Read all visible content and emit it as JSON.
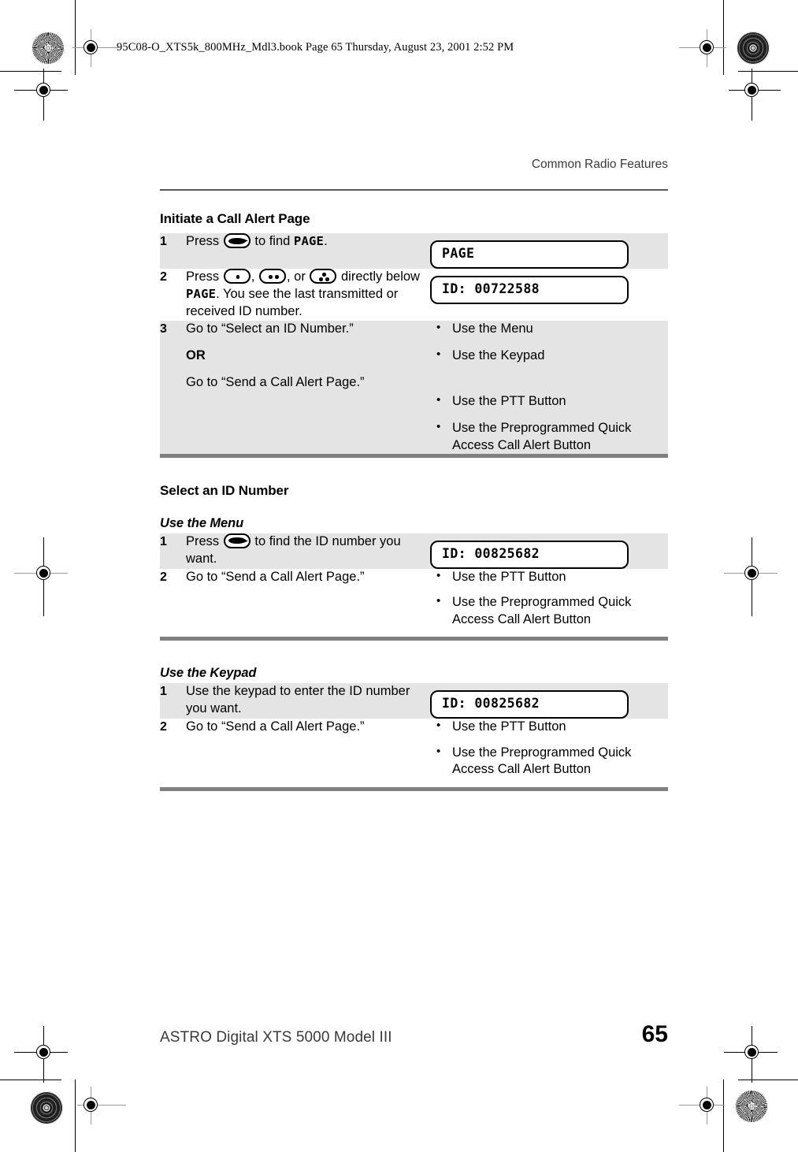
{
  "slug": "95C08-O_XTS5k_800MHz_Mdl3.book  Page 65  Thursday, August 23, 2001  2:52 PM",
  "running_head": "Common Radio Features",
  "footer": {
    "title": "ASTRO Digital XTS 5000 Model III",
    "page_number": "65"
  },
  "colors": {
    "row_shade": "#e4e4e4",
    "rule": "#58585a",
    "table_bottom_rule": "#808082",
    "text": "#000000",
    "head_text": "#3a3a3a"
  },
  "sections": [
    {
      "heading": "Initiate a Call Alert Page",
      "subheading": null,
      "rows": [
        {
          "number": "1",
          "text_lead": "Press",
          "icons": [
            "oval-arrow-button-icon"
          ],
          "text_tail": "to find",
          "mono_word": "PAGE",
          "text_end": ".",
          "display": "PAGE",
          "shaded": true
        },
        {
          "number": "2",
          "text_lead": "Press",
          "icons": [
            "one-dot-button-icon",
            "two-dot-button-icon",
            "three-dot-button-icon"
          ],
          "text_tail_1": ", ",
          "text_tail_2": ", or ",
          "text_after": "directly below",
          "mono_word": "PAGE",
          "text_rest": ". You see the last transmitted or received ID number.",
          "display": "ID: 00722588",
          "shaded": false
        },
        {
          "number": "3",
          "text_a": "Go to “Select an ID Number.”",
          "text_or": "OR",
          "text_b": "Go to “Send a Call Alert Page.”",
          "bullets": [
            "Use the Menu",
            "Use the Keypad",
            "",
            "Use the PTT Button",
            "Use the Preprogrammed Quick Access Call Alert Button"
          ],
          "shaded": true
        }
      ]
    },
    {
      "heading": "Select an ID Number",
      "subheading": "Use the Menu",
      "rows": [
        {
          "number": "1",
          "text_lead": "Press",
          "icons": [
            "oval-arrow-button-icon"
          ],
          "text_tail": "to find the ID number you want.",
          "display": "ID: 00825682",
          "shaded": true
        },
        {
          "number": "2",
          "text_a": "Go to “Send a Call Alert Page.”",
          "bullets": [
            "Use the PTT Button",
            "Use the Preprogrammed Quick Access Call Alert Button"
          ],
          "shaded": false
        }
      ]
    },
    {
      "heading": null,
      "subheading": "Use the Keypad",
      "rows": [
        {
          "number": "1",
          "text_a": "Use the keypad to enter the ID number you want.",
          "display": "ID: 00825682",
          "shaded": true
        },
        {
          "number": "2",
          "text_a": "Go to “Send a Call Alert Page.”",
          "bullets": [
            "Use the PTT Button",
            "Use the Preprogrammed Quick Access Call Alert Button"
          ],
          "shaded": false
        }
      ]
    }
  ],
  "s1": {
    "heading": "Initiate a Call Alert Page",
    "r1_num": "1",
    "r1_press": "Press",
    "r1_tofind": "to find",
    "r1_page": "PAGE",
    "r1_period": ".",
    "r1_display": "PAGE",
    "r2_num": "2",
    "r2_press": "Press",
    "r2_comma": ",",
    "r2_or": ", or",
    "r2_below": "directly below",
    "r2_page": "PAGE",
    "r2_rest": ". You see the last transmitted or received ID number.",
    "r2_display": "ID: 00722588",
    "r3_num": "3",
    "r3_a": "Go to “Select an ID Number.”",
    "r3_or": "OR",
    "r3_b": "Go to “Send a Call Alert Page.”",
    "r3_b1": "Use the Menu",
    "r3_b2": "Use the Keypad",
    "r3_b3": "Use the PTT Button",
    "r3_b4": "Use the Preprogrammed Quick Access Call Alert Button"
  },
  "s2": {
    "heading": "Select an ID Number",
    "subheading": "Use the Menu",
    "r1_num": "1",
    "r1_press": "Press",
    "r1_tail": "to find the ID number you want.",
    "r1_display": "ID: 00825682",
    "r2_num": "2",
    "r2_a": "Go to “Send a Call Alert Page.”",
    "r2_b1": "Use the PTT Button",
    "r2_b2": "Use the Preprogrammed Quick Access Call Alert Button"
  },
  "s3": {
    "subheading": "Use the Keypad",
    "r1_num": "1",
    "r1_a": "Use the keypad to enter the ID number you want.",
    "r1_display": "ID: 00825682",
    "r2_num": "2",
    "r2_a": "Go to “Send a Call Alert Page.”",
    "r2_b1": "Use the PTT Button",
    "r2_b2": "Use the Preprogrammed Quick Access Call Alert Button"
  }
}
